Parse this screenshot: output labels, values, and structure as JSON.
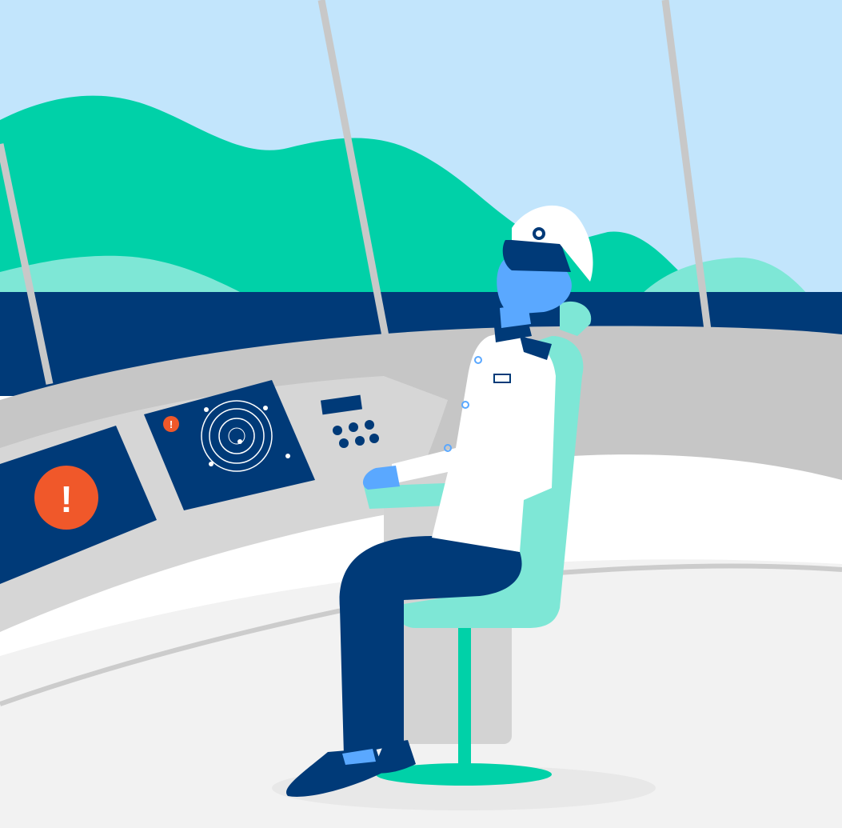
{
  "illustration": {
    "subject": "",
    "colors": {
      "sky": "#c2e5fc",
      "hills_main": "#00d1a8",
      "hills_light": "#7ee7d6",
      "sea": "#003a78",
      "frame_pillar": "#c8c8c8",
      "dashboard_top": "#c6c6c6",
      "dashboard_face": "#d6d6d6",
      "panel": "#003a78",
      "alert": "#f0582a",
      "radar_ring": "#ffffff",
      "chair": "#7ee7d6",
      "chair_base": "#00d1a8",
      "uniform": "#ffffff",
      "trousers": "#003a78",
      "skin": "#5aa8ff",
      "floor": "#f2f2f2"
    },
    "icons": [
      "alert-icon",
      "radar-icon",
      "captain-hat-icon",
      "keypad-icon"
    ],
    "alert_glyph": "!",
    "small_alert_glyph": "!"
  }
}
